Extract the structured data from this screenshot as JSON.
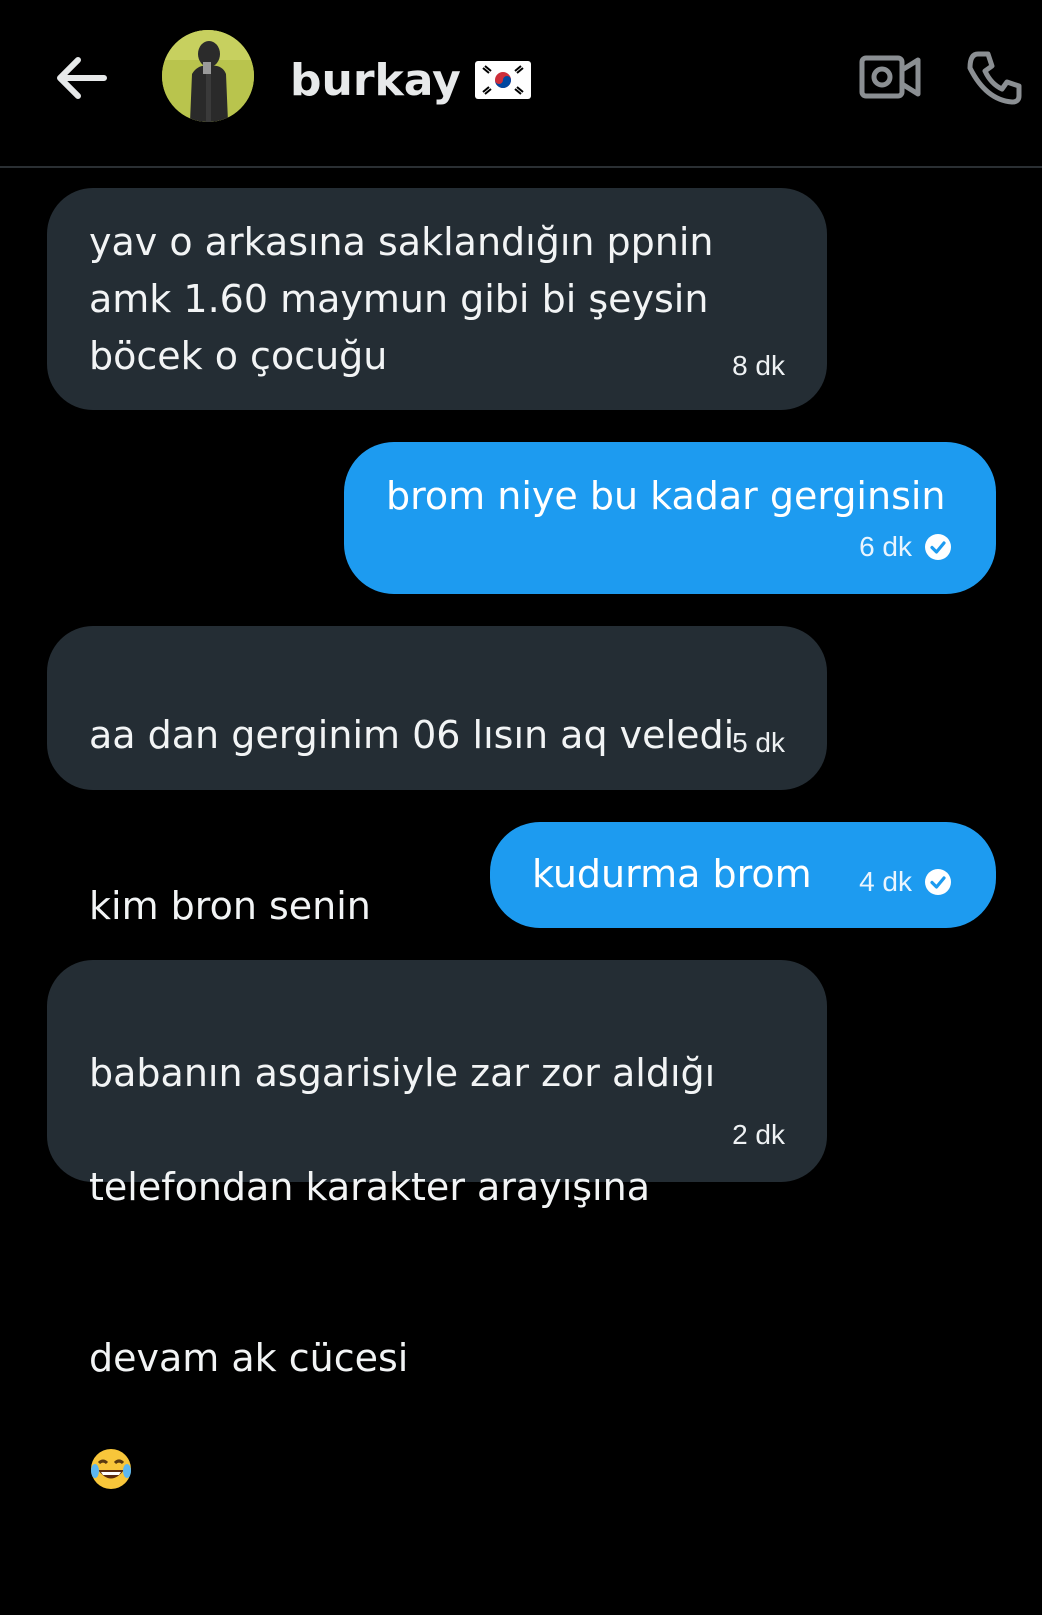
{
  "header": {
    "back_icon": "arrow-left-icon",
    "contact_name": "burkay",
    "flag_icon": "south-korea-flag-icon",
    "video_icon": "video-camera-icon",
    "call_icon": "phone-icon"
  },
  "colors": {
    "background": "#000000",
    "received_bubble": "#242d34",
    "sent_bubble": "#1d9bf0"
  },
  "messages": [
    {
      "direction": "received",
      "text": "yav o arkasına saklandığın ppnin\namk 1.60 maymun gibi bi şeysin\nböcek o çocuğu",
      "time": "8 dk"
    },
    {
      "direction": "sent",
      "text": "brom niye bu kadar gerginsin",
      "time": "6 dk",
      "status_icon": "read-check-icon"
    },
    {
      "direction": "received",
      "text_line1": "aa dan gerginim 06 lısın aq veledi",
      "text_line2": "kim bron senin",
      "emojis": "😂😂😂",
      "time": "5 dk"
    },
    {
      "direction": "sent",
      "text": "kudurma brom",
      "time": "4 dk",
      "status_icon": "read-check-icon"
    },
    {
      "direction": "received",
      "text_line1": "babanın asgarisiyle zar zor aldığı",
      "text_line2": "telefondan karakter arayışına",
      "text_line3": "devam ak cücesi",
      "emojis": "😂",
      "time": "2 dk"
    }
  ]
}
